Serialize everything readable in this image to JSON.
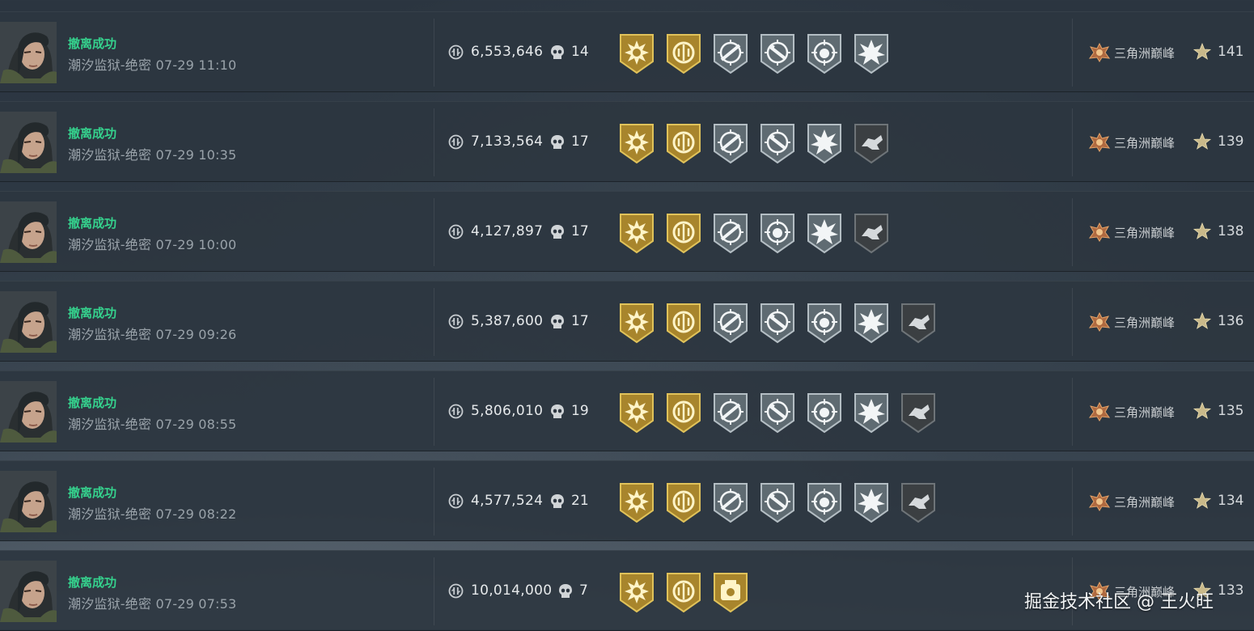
{
  "rows": [
    {
      "status": "撤离成功",
      "map": "潮汐监狱-绝密",
      "time": "07-29 11:10",
      "value": "6,553,646",
      "kills": "14",
      "badges": [
        "gold-sun",
        "gold-round",
        "silver-aim",
        "silver-aim2",
        "silver-crosshair",
        "silver-burst"
      ],
      "rank": "三角洲巅峰",
      "level": "141"
    },
    {
      "status": "撤离成功",
      "map": "潮汐监狱-绝密",
      "time": "07-29 10:35",
      "value": "7,133,564",
      "kills": "17",
      "badges": [
        "gold-sun",
        "gold-round",
        "silver-aim",
        "silver-aim2",
        "silver-burst",
        "dark-hand"
      ],
      "rank": "三角洲巅峰",
      "level": "139"
    },
    {
      "status": "撤离成功",
      "map": "潮汐监狱-绝密",
      "time": "07-29 10:00",
      "value": "4,127,897",
      "kills": "17",
      "badges": [
        "gold-sun",
        "gold-round",
        "silver-aim",
        "silver-crosshair",
        "silver-burst",
        "dark-hand"
      ],
      "rank": "三角洲巅峰",
      "level": "138"
    },
    {
      "status": "撤离成功",
      "map": "潮汐监狱-绝密",
      "time": "07-29 09:26",
      "value": "5,387,600",
      "kills": "17",
      "badges": [
        "gold-sun",
        "gold-round",
        "silver-aim",
        "silver-aim2",
        "silver-crosshair",
        "silver-burst",
        "dark-hand"
      ],
      "rank": "三角洲巅峰",
      "level": "136"
    },
    {
      "status": "撤离成功",
      "map": "潮汐监狱-绝密",
      "time": "07-29 08:55",
      "value": "5,806,010",
      "kills": "19",
      "badges": [
        "gold-sun",
        "gold-round",
        "silver-aim",
        "silver-aim2",
        "silver-crosshair",
        "silver-burst",
        "dark-hand"
      ],
      "rank": "三角洲巅峰",
      "level": "135"
    },
    {
      "status": "撤离成功",
      "map": "潮汐监狱-绝密",
      "time": "07-29 08:22",
      "value": "4,577,524",
      "kills": "21",
      "badges": [
        "gold-sun",
        "gold-round",
        "silver-aim",
        "silver-aim2",
        "silver-crosshair",
        "silver-burst",
        "dark-hand"
      ],
      "rank": "三角洲巅峰",
      "level": "134"
    },
    {
      "status": "撤离成功",
      "map": "潮汐监狱-绝密",
      "time": "07-29 07:53",
      "value": "10,014,000",
      "kills": "7",
      "badges": [
        "gold-sun",
        "gold-round",
        "gold-vault"
      ],
      "rank": "三角洲巅峰",
      "level": "133"
    }
  ],
  "colors": {
    "success": "#35d18d",
    "gold": "#c9a23a",
    "silver": "#9aa6ad",
    "dark": "#5a5f63"
  },
  "watermark": "掘金技术社区 @ 王火旺"
}
